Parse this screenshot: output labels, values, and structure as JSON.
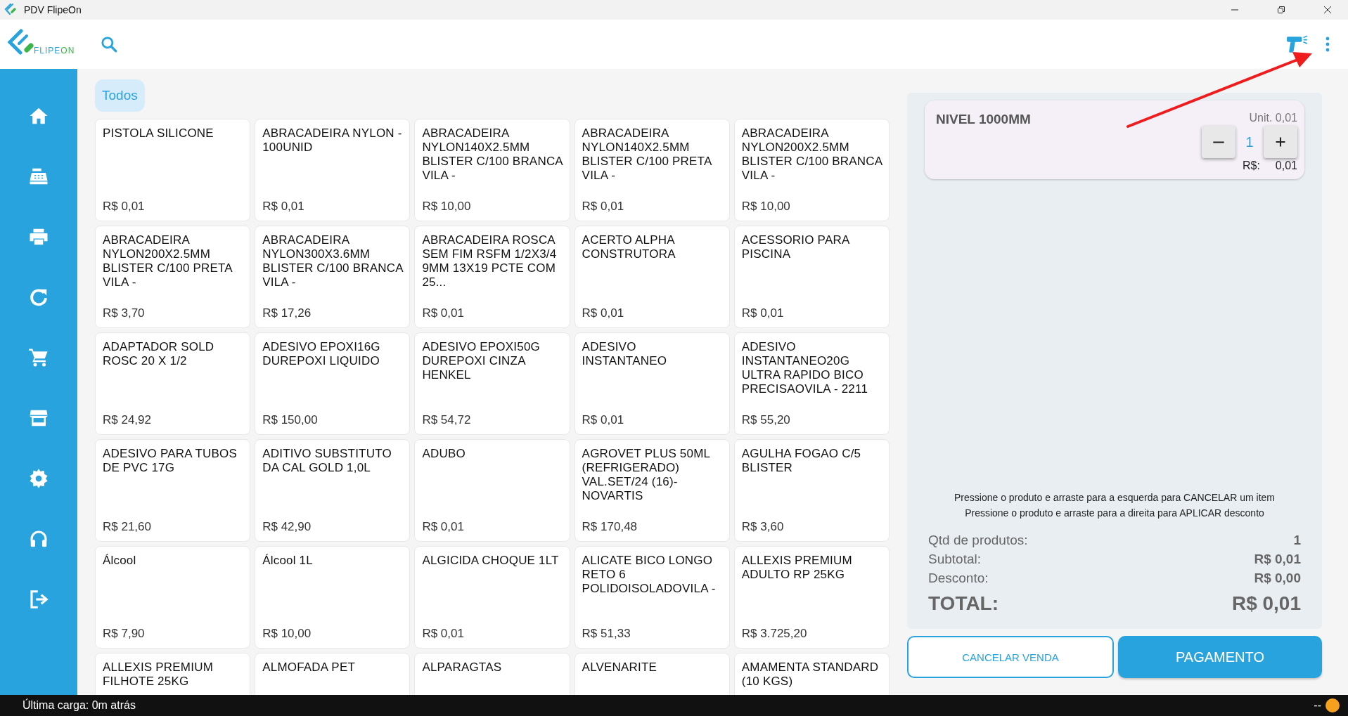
{
  "window": {
    "title": "PDV FlipeOn"
  },
  "logo": {
    "primary": "FLIPE",
    "accent": "ON"
  },
  "sidebar": {
    "items": [
      {
        "kind": "home"
      },
      {
        "kind": "register"
      },
      {
        "kind": "printer"
      },
      {
        "kind": "refresh"
      },
      {
        "kind": "cart"
      },
      {
        "kind": "store"
      },
      {
        "kind": "settings"
      },
      {
        "kind": "support"
      },
      {
        "kind": "logout"
      }
    ]
  },
  "categories": [
    {
      "label": "Todos",
      "selected": true
    }
  ],
  "products": [
    {
      "name": "PISTOLA SILICONE",
      "price": "R$ 0,01"
    },
    {
      "name": "ABRACADEIRA NYLON - 100UNID",
      "price": "R$ 0,01"
    },
    {
      "name": "ABRACADEIRA NYLON140X2.5MM BLISTER C/100 BRANCA VILA -",
      "price": "R$ 10,00"
    },
    {
      "name": "ABRACADEIRA NYLON140X2.5MM BLISTER C/100 PRETA VILA -",
      "price": "R$ 0,01"
    },
    {
      "name": "ABRACADEIRA NYLON200X2.5MM BLISTER C/100 BRANCA VILA -",
      "price": "R$ 10,00"
    },
    {
      "name": "ABRACADEIRA NYLON200X2.5MM BLISTER C/100 PRETA VILA -",
      "price": "R$ 3,70"
    },
    {
      "name": "ABRACADEIRA NYLON300X3.6MM BLISTER C/100 BRANCA VILA -",
      "price": "R$ 17,26"
    },
    {
      "name": "ABRACADEIRA ROSCA SEM FIM RSFM 1/2X3/4 9MM 13X19 PCTE COM 25...",
      "price": "R$ 0,01"
    },
    {
      "name": "ACERTO ALPHA CONSTRUTORA",
      "price": "R$ 0,01"
    },
    {
      "name": "ACESSORIO PARA PISCINA",
      "price": "R$ 0,01"
    },
    {
      "name": "ADAPTADOR SOLD ROSC 20 X 1/2",
      "price": "R$ 24,92"
    },
    {
      "name": "ADESIVO EPOXI16G DUREPOXI LIQUIDO",
      "price": "R$ 150,00"
    },
    {
      "name": "ADESIVO EPOXI50G DUREPOXI CINZA HENKEL",
      "price": "R$ 54,72"
    },
    {
      "name": "ADESIVO INSTANTANEO",
      "price": "R$ 0,01"
    },
    {
      "name": "ADESIVO INSTANTANEO20G ULTRA RAPIDO BICO PRECISAOVILA - 2211",
      "price": "R$ 55,20"
    },
    {
      "name": "ADESIVO PARA TUBOS DE PVC 17G",
      "price": "R$ 21,60"
    },
    {
      "name": "ADITIVO SUBSTITUTO DA CAL GOLD 1,0L",
      "price": "R$ 42,90"
    },
    {
      "name": "ADUBO",
      "price": "R$ 0,01"
    },
    {
      "name": "AGROVET PLUS 50ML (REFRIGERADO) VAL.SET/24 (16)-NOVARTIS",
      "price": "R$ 170,48"
    },
    {
      "name": "AGULHA FOGAO C/5 BLISTER",
      "price": "R$ 3,60"
    },
    {
      "name": "Álcool",
      "price": "R$ 7,90"
    },
    {
      "name": "Álcool 1L",
      "price": "R$ 10,00"
    },
    {
      "name": "ALGICIDA CHOQUE 1LT",
      "price": "R$ 0,01"
    },
    {
      "name": "ALICATE BICO LONGO RETO 6 POLIDOISOLADOVILA -",
      "price": "R$ 51,33"
    },
    {
      "name": "ALLEXIS PREMIUM ADULTO RP 25KG",
      "price": "R$ 3.725,20"
    },
    {
      "name": "ALLEXIS PREMIUM FILHOTE 25KG"
    },
    {
      "name": "ALMOFADA PET"
    },
    {
      "name": "ALPARAGTAS"
    },
    {
      "name": "ALVENARITE"
    },
    {
      "name": "AMAMENTA STANDARD (10 KGS)"
    }
  ],
  "cart": {
    "items": [
      {
        "name": "NIVEL 1000MM",
        "unit": "Unit. 0,01",
        "quantity": "1",
        "currency": "R$:",
        "total": "0,01"
      }
    ],
    "hints": [
      "Pressione o produto e arraste para a esquerda para CANCELAR um item",
      "Pressione o produto e arraste para a direita para APLICAR desconto"
    ],
    "summary": [
      {
        "label": "Qtd de produtos:",
        "value": "1"
      },
      {
        "label": "Subtotal:",
        "value": "R$ 0,01"
      },
      {
        "label": "Desconto:",
        "value": "R$ 0,00"
      }
    ],
    "total": {
      "label": "TOTAL:",
      "value": "R$ 0,01"
    }
  },
  "buttons": {
    "cancel": "CANCELAR VENDA",
    "pay": "PAGAMENTO"
  },
  "status_bar": {
    "text": "Última carga: 0m atrás",
    "indicator": "--"
  }
}
